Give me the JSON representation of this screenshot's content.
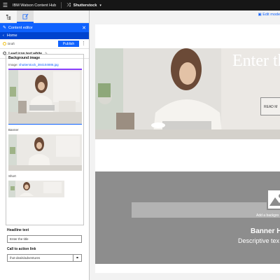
{
  "topbar": {
    "menu_icon": "hamburger-icon",
    "product": "IBM Watson Content Hub",
    "site_icon": "shuffle-icon",
    "site": "Shutterstock"
  },
  "sidebar": {
    "tabs": [
      {
        "icon": "tree-icon",
        "active": false
      },
      {
        "icon": "content-edit-icon",
        "active": true
      }
    ],
    "header_title": "Content editor",
    "home_label": "Home",
    "status": "Draft",
    "publish_label": "Publish",
    "item_name": "Lead icon text white",
    "background_label": "Background image",
    "image_prefix": "Image:",
    "image_filename": "shutterstock_384104886.jpg",
    "renditions": [
      "Banner",
      "Short"
    ],
    "headline_label": "Headline text",
    "headline_value": "Enter the title",
    "cta_label": "Call to action link",
    "cta_value": "/hot-deals/adventures"
  },
  "canvas": {
    "edit_mode": "Edit mode",
    "hero_title": "Enter th",
    "read_more": "READ M",
    "banner_add": "Add a backgro",
    "banner_title": "Banner H",
    "banner_desc": "Descriptive tex"
  },
  "colors": {
    "accent": "#0f62fe",
    "topbar": "#161616",
    "banner_gray": "#8d8d8d"
  }
}
